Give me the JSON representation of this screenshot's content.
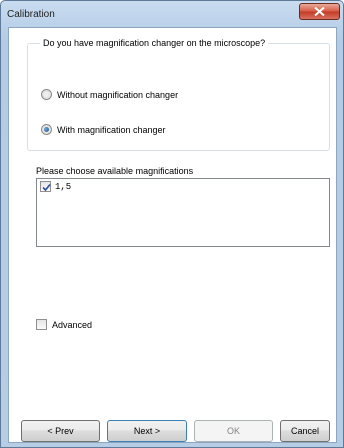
{
  "window": {
    "title": "Calibration"
  },
  "groupbox": {
    "title": "Do you have magnification changer on the microscope?",
    "options": [
      {
        "label": "Without magnification changer",
        "selected": false
      },
      {
        "label": "With magnification changer",
        "selected": true
      }
    ]
  },
  "magnifications": {
    "label": "Please choose available magnifications",
    "items": [
      {
        "label": "1,5",
        "checked": true
      }
    ]
  },
  "advanced": {
    "label": "Advanced",
    "checked": false
  },
  "buttons": {
    "prev": "< Prev",
    "next": "Next >",
    "ok": "OK",
    "cancel": "Cancel"
  },
  "colors": {
    "title_bar": "#b9cfe7",
    "close_button": "#c94a35",
    "focus_border": "#3c7fb1"
  }
}
